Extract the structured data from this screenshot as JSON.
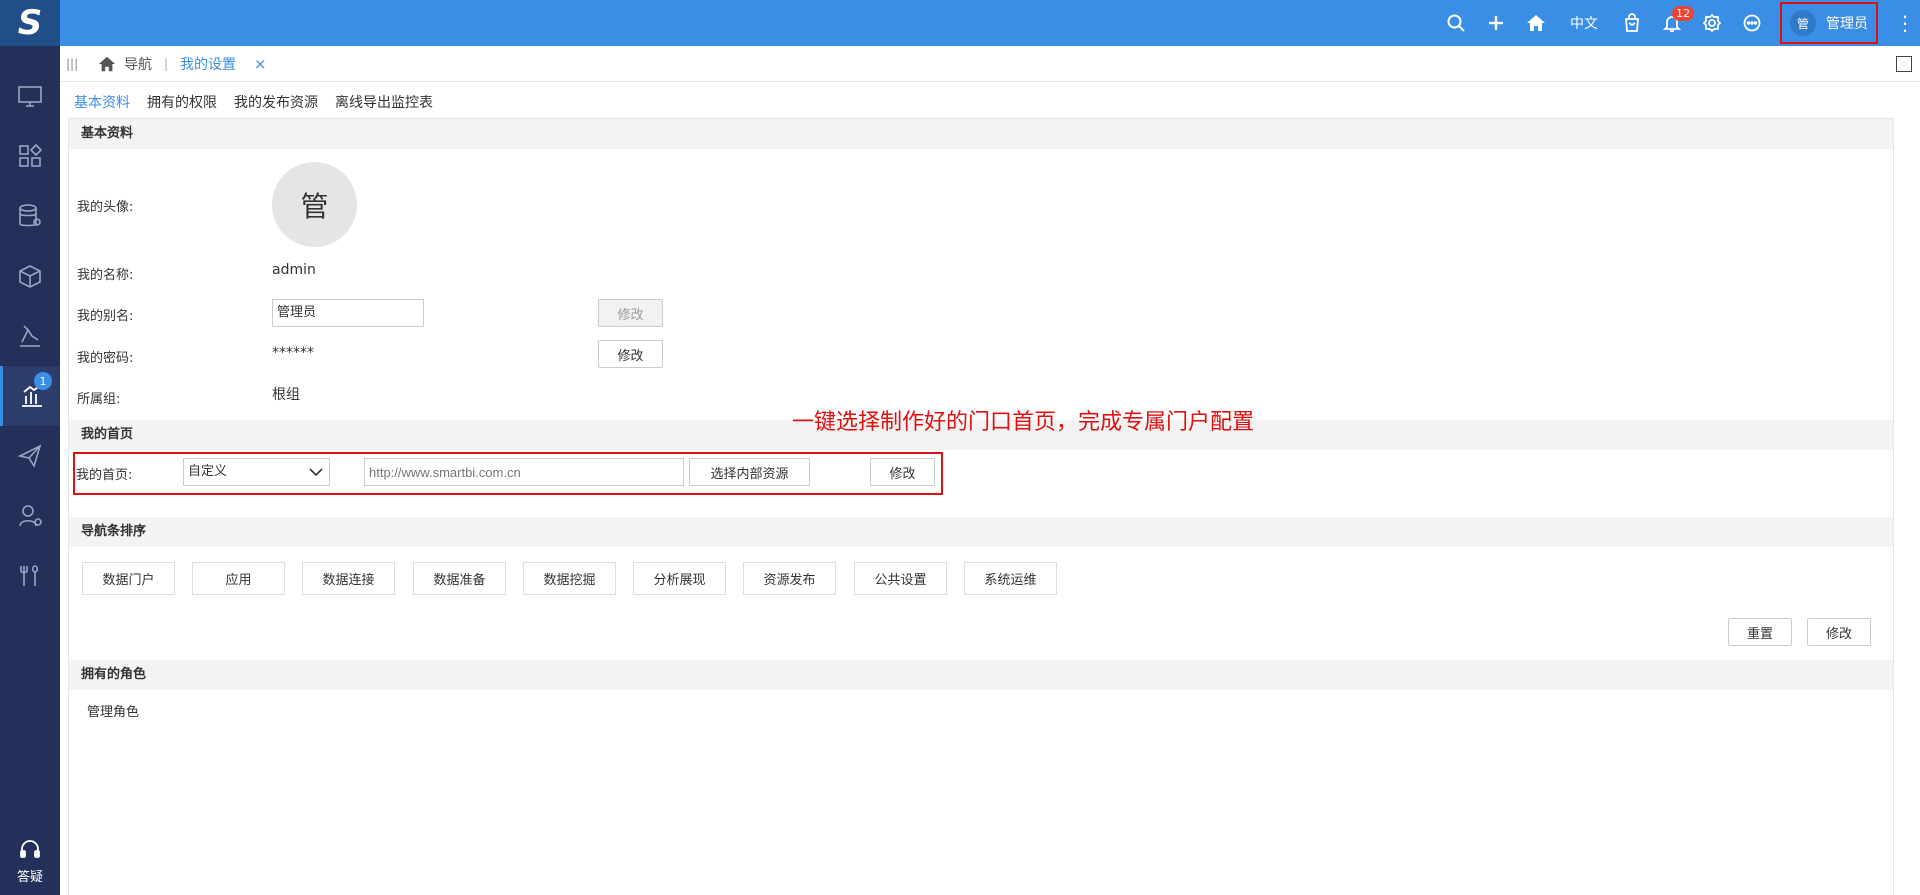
{
  "header": {
    "logo_letter": "S",
    "language": "中文",
    "notification_count": "12",
    "user_avatar_char": "管",
    "user_name": "管理员"
  },
  "sidebar": {
    "active_badge": "1",
    "help_label": "答疑"
  },
  "tabbar": {
    "home_label": "导航",
    "separator": "|",
    "active_tab": "我的设置",
    "close_symbol": "×"
  },
  "subtabs": [
    "基本资料",
    "拥有的权限",
    "我的发布资源",
    "离线导出监控表"
  ],
  "basic": {
    "section_title": "基本资料",
    "avatar_label": "我的头像:",
    "avatar_char": "管",
    "name_label": "我的名称:",
    "name_value": "admin",
    "alias_label": "我的别名:",
    "alias_value": "管理员",
    "alias_button": "修改",
    "password_label": "我的密码:",
    "password_value": "******",
    "password_button": "修改",
    "group_label": "所属组:",
    "group_value": "根组"
  },
  "homepage": {
    "section_title": "我的首页",
    "label": "我的首页:",
    "select_value": "自定义",
    "url_placeholder": "http://www.smartbi.com.cn",
    "choose_button": "选择内部资源",
    "modify_button": "修改",
    "annotation": "一键选择制作好的门口首页，完成专属门户配置"
  },
  "navorder": {
    "section_title": "导航条排序",
    "items": [
      "数据门户",
      "应用",
      "数据连接",
      "数据准备",
      "数据挖掘",
      "分析展现",
      "资源发布",
      "公共设置",
      "系统运维"
    ],
    "reset_button": "重置",
    "modify_button": "修改"
  },
  "roles": {
    "section_title": "拥有的角色",
    "value": "管理角色"
  }
}
